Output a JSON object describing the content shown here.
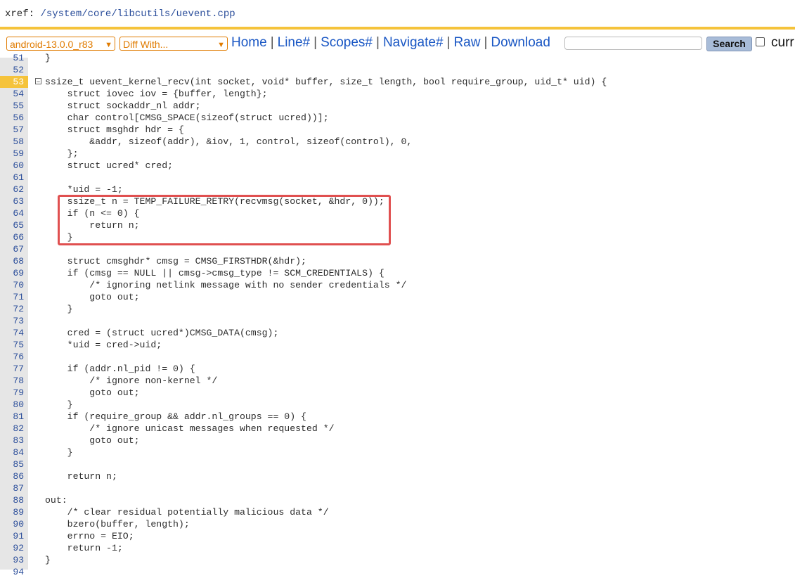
{
  "header": {
    "xref_prefix": "xref: ",
    "path_parts": [
      "/system",
      "/core",
      "/libcutils",
      "/uevent.cpp"
    ]
  },
  "toolbar": {
    "version_select": "android-13.0.0_r83",
    "diff_select": "Diff With...",
    "links": [
      "Home",
      "Line#",
      "Scopes#",
      "Navigate#",
      "Raw",
      "Download"
    ],
    "search_value": "",
    "search_button": "Search",
    "current_label": "curr"
  },
  "code": {
    "highlighted_line": 53,
    "lines": [
      {
        "n": "51",
        "t": "}"
      },
      {
        "n": "52",
        "t": ""
      },
      {
        "n": "53",
        "t": "ssize_t uevent_kernel_recv(int socket, void* buffer, size_t length, bool require_group, uid_t* uid) {"
      },
      {
        "n": "54",
        "t": "    struct iovec iov = {buffer, length};"
      },
      {
        "n": "55",
        "t": "    struct sockaddr_nl addr;"
      },
      {
        "n": "56",
        "t": "    char control[CMSG_SPACE(sizeof(struct ucred))];"
      },
      {
        "n": "57",
        "t": "    struct msghdr hdr = {"
      },
      {
        "n": "58",
        "t": "        &addr, sizeof(addr), &iov, 1, control, sizeof(control), 0,"
      },
      {
        "n": "59",
        "t": "    };"
      },
      {
        "n": "60",
        "t": "    struct ucred* cred;"
      },
      {
        "n": "61",
        "t": ""
      },
      {
        "n": "62",
        "t": "    *uid = -1;"
      },
      {
        "n": "63",
        "t": "    ssize_t n = TEMP_FAILURE_RETRY(recvmsg(socket, &hdr, 0));"
      },
      {
        "n": "64",
        "t": "    if (n <= 0) {"
      },
      {
        "n": "65",
        "t": "        return n;"
      },
      {
        "n": "66",
        "t": "    }"
      },
      {
        "n": "67",
        "t": ""
      },
      {
        "n": "68",
        "t": "    struct cmsghdr* cmsg = CMSG_FIRSTHDR(&hdr);"
      },
      {
        "n": "69",
        "t": "    if (cmsg == NULL || cmsg->cmsg_type != SCM_CREDENTIALS) {"
      },
      {
        "n": "70",
        "t": "        /* ignoring netlink message with no sender credentials */"
      },
      {
        "n": "71",
        "t": "        goto out;"
      },
      {
        "n": "72",
        "t": "    }"
      },
      {
        "n": "73",
        "t": ""
      },
      {
        "n": "74",
        "t": "    cred = (struct ucred*)CMSG_DATA(cmsg);"
      },
      {
        "n": "75",
        "t": "    *uid = cred->uid;"
      },
      {
        "n": "76",
        "t": ""
      },
      {
        "n": "77",
        "t": "    if (addr.nl_pid != 0) {"
      },
      {
        "n": "78",
        "t": "        /* ignore non-kernel */"
      },
      {
        "n": "79",
        "t": "        goto out;"
      },
      {
        "n": "80",
        "t": "    }"
      },
      {
        "n": "81",
        "t": "    if (require_group && addr.nl_groups == 0) {"
      },
      {
        "n": "82",
        "t": "        /* ignore unicast messages when requested */"
      },
      {
        "n": "83",
        "t": "        goto out;"
      },
      {
        "n": "84",
        "t": "    }"
      },
      {
        "n": "85",
        "t": ""
      },
      {
        "n": "86",
        "t": "    return n;"
      },
      {
        "n": "87",
        "t": ""
      },
      {
        "n": "88",
        "t": "out:"
      },
      {
        "n": "89",
        "t": "    /* clear residual potentially malicious data */"
      },
      {
        "n": "90",
        "t": "    bzero(buffer, length);"
      },
      {
        "n": "91",
        "t": "    errno = EIO;"
      },
      {
        "n": "92",
        "t": "    return -1;"
      },
      {
        "n": "93",
        "t": "}"
      },
      {
        "n": "94",
        "t": ""
      }
    ]
  },
  "colors": {
    "accent": "#f5c33b",
    "link": "#1a57c4",
    "annotation_box": "#e05050"
  }
}
